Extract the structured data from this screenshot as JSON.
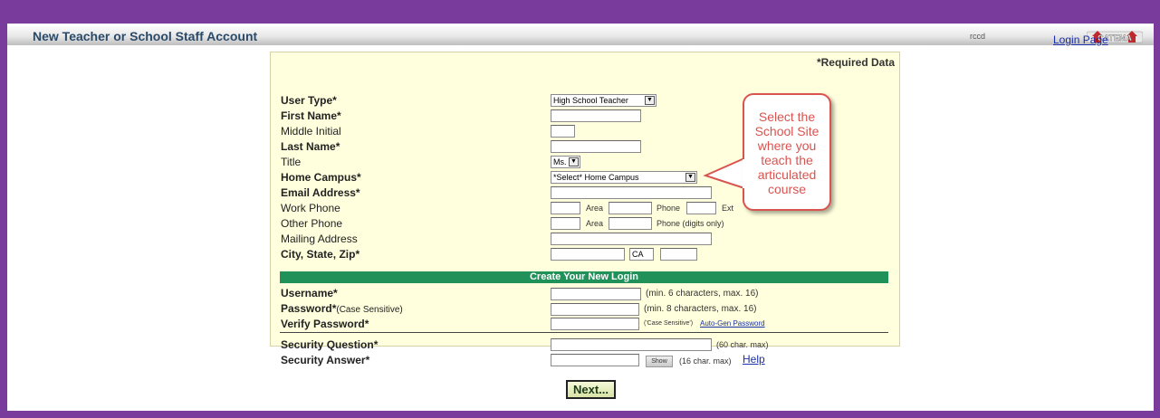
{
  "window": {
    "title": "New Teacher or School Staff Account",
    "user": "rccd",
    "logo_text": "CATEMA"
  },
  "nav": {
    "login_page": "Login Page"
  },
  "form": {
    "required_note": "*Required Data",
    "user_type": {
      "label": "User Type",
      "value": "High School Teacher"
    },
    "first_name": {
      "label": "First Name"
    },
    "middle_initial": {
      "label": "Middle Initial"
    },
    "last_name": {
      "label": "Last Name"
    },
    "title": {
      "label": "Title",
      "value": "Ms."
    },
    "home_campus": {
      "label": "Home Campus",
      "value": "*Select* Home Campus"
    },
    "email": {
      "label": "Email Address"
    },
    "work_phone": {
      "label": "Work Phone",
      "area": "Area",
      "phone": "Phone",
      "ext": "Ext"
    },
    "other_phone": {
      "label": "Other Phone",
      "area": "Area",
      "phone": "Phone  (digits only)"
    },
    "mailing_address": {
      "label": "Mailing Address"
    },
    "city_state_zip": {
      "label": "City, State, Zip",
      "state": "CA"
    },
    "login_section": "Create Your New Login",
    "username": {
      "label": "Username",
      "hint": "(min. 6 characters, max. 16)"
    },
    "password": {
      "label": "Password",
      "label_small": "(Case Sensitive)",
      "hint": "(min. 8 characters, max. 16)"
    },
    "verify_password": {
      "label": "Verify Password",
      "hint": "('Case Sensitive')",
      "link": "Auto-Gen Password"
    },
    "security_question": {
      "label": "Security Question",
      "hint": "(60 char. max)"
    },
    "security_answer": {
      "label": "Security Answer",
      "show": "Show",
      "hint": "(16 char. max)",
      "help": "Help"
    },
    "required_mark": "*"
  },
  "callout": {
    "lines": [
      "Select the",
      "School Site",
      "where you",
      "teach the",
      "articulated",
      "course"
    ],
    "color": "#d9534f"
  },
  "next_button": "Next...",
  "colors": {
    "frame": "#7a3c9c",
    "panel": "#ffffdd",
    "section_bar": "#21915a"
  }
}
